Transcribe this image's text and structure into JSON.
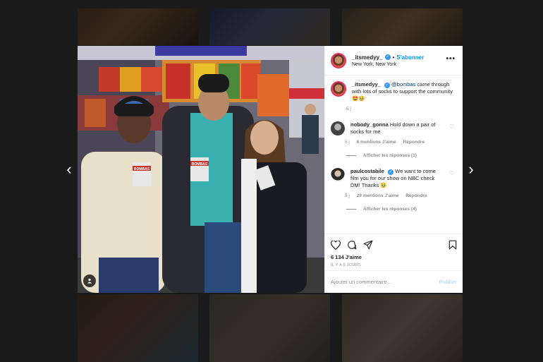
{
  "post": {
    "author": "_itsmedyy_",
    "follow_label": "S'abonner",
    "separator": "•",
    "location": "New York, New York",
    "more_label": "•••",
    "caption_mention": "@bombas",
    "caption_text": " came through with lots of socks to support the community 🤩🥹",
    "caption_time": "5 j"
  },
  "photo": {
    "sock_brand": "BOMBAS"
  },
  "comments": [
    {
      "username": "nobody_gonna",
      "text": "Hold down a pair of socks for me",
      "time": "5 j",
      "likes": "6 mentions J'aime",
      "reply": "Répondre",
      "view_replies": "Afficher les réponses (1)"
    },
    {
      "username": "paulcostabile",
      "text": "We want to come film you for our show on NBC check DM! Thanks 🥹",
      "time": "5 j",
      "likes": "29 mentions J'aime",
      "reply": "Répondre",
      "view_replies": "Afficher les réponses (4)"
    }
  ],
  "actions": {
    "likes_count": "6 134 J'aime",
    "time_ago": "IL Y A 5 JOURS"
  },
  "add_comment": {
    "placeholder": "Ajouter un commentaire...",
    "publish_label": "Publier"
  },
  "icons": {
    "nav_prev": "‹",
    "nav_next": "›",
    "like": "heart-icon",
    "comment": "comment-icon",
    "share": "share-icon",
    "save": "bookmark-icon",
    "tag": "user-tag-icon",
    "heart_small": "♡",
    "verified_mark": "✓"
  },
  "colors": {
    "accent": "#0095f6",
    "verified": "#3897f0",
    "publish_disabled": "#b3dbff",
    "story_ring": "#e1306c"
  }
}
